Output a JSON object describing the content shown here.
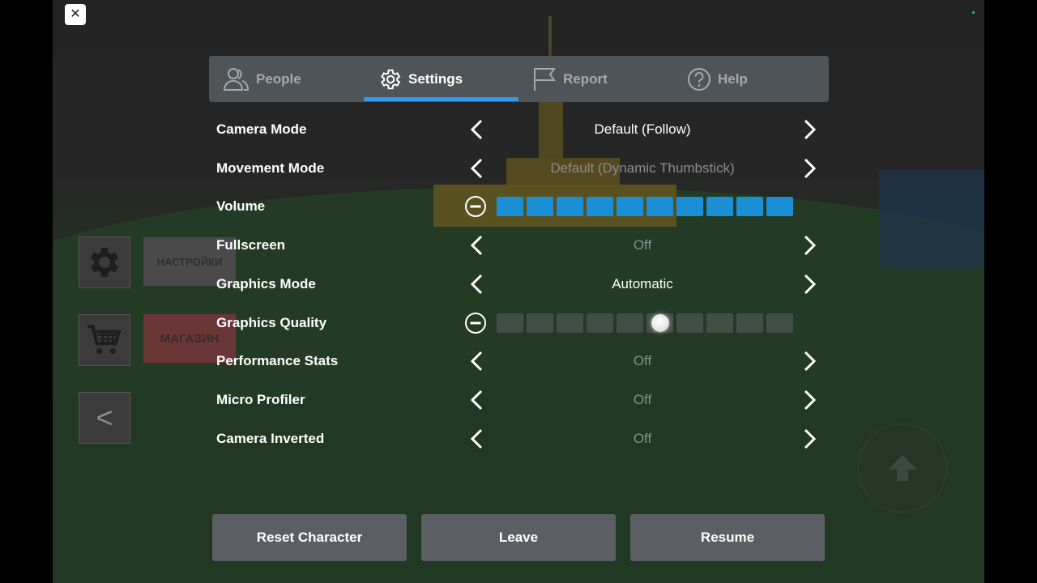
{
  "close_label": "✕",
  "left_panel": {
    "settings_label": "НАСТРОЙКИ",
    "shop_label": "МАГАЗИН",
    "back_label": "<"
  },
  "tabs": [
    {
      "label": "People",
      "icon": "people-icon",
      "active": false
    },
    {
      "label": "Settings",
      "icon": "gear-icon",
      "active": true
    },
    {
      "label": "Report",
      "icon": "flag-icon",
      "active": false
    },
    {
      "label": "Help",
      "icon": "help-icon",
      "active": false
    }
  ],
  "settings": {
    "camera_mode": {
      "label": "Camera Mode",
      "value": "Default (Follow)"
    },
    "movement_mode": {
      "label": "Movement Mode",
      "value": "Default (Dynamic Thumbstick)"
    },
    "volume": {
      "label": "Volume",
      "level": 10,
      "max": 10
    },
    "fullscreen": {
      "label": "Fullscreen",
      "value": "Off"
    },
    "graphics_mode": {
      "label": "Graphics Mode",
      "value": "Automatic"
    },
    "graphics_quality": {
      "label": "Graphics Quality",
      "level": 6,
      "max": 10
    },
    "performance_stats": {
      "label": "Performance Stats",
      "value": "Off"
    },
    "micro_profiler": {
      "label": "Micro Profiler",
      "value": "Off"
    },
    "camera_inverted": {
      "label": "Camera Inverted",
      "value": "Off"
    }
  },
  "buttons": {
    "reset": "Reset Character",
    "leave": "Leave",
    "resume": "Resume"
  },
  "colors": {
    "accent": "#2f9bf0",
    "volume_segment": "#1a8fd6",
    "tabbar_bg": "#4f5459",
    "button_bg": "#5b5f64"
  }
}
